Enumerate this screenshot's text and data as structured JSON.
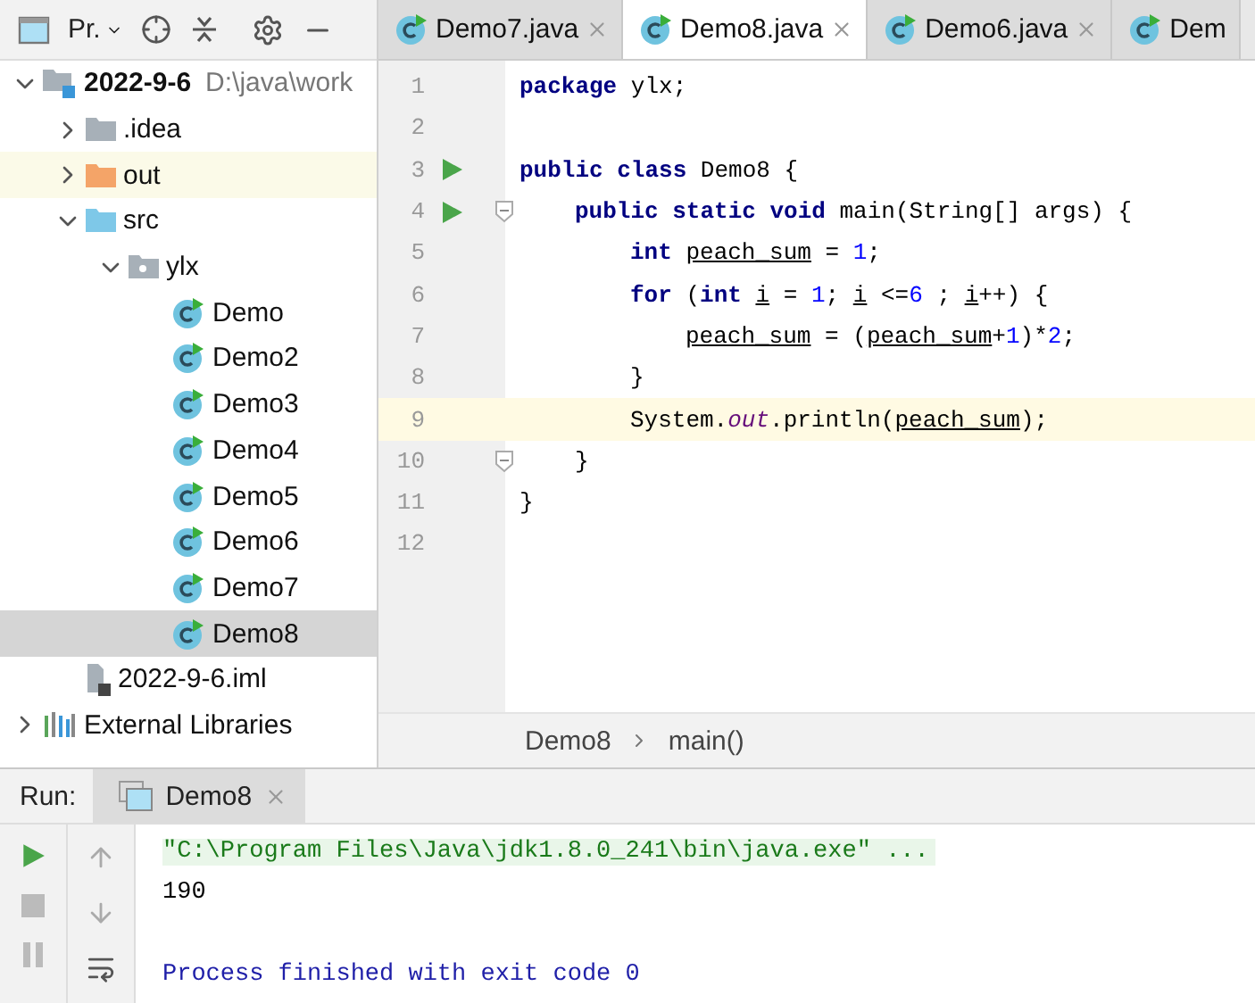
{
  "project_panel": {
    "title": "Pr.",
    "tree": [
      {
        "label": "2022-9-6",
        "path": "D:\\java\\work",
        "kind": "module",
        "expanded": true,
        "selected": false,
        "highlighted": false,
        "children": [
          {
            "label": ".idea",
            "kind": "folder",
            "expanded": false,
            "selected": false,
            "highlighted": false
          },
          {
            "label": "out",
            "kind": "output-folder",
            "expanded": false,
            "selected": false,
            "highlighted": true
          },
          {
            "label": "src",
            "kind": "source-folder",
            "expanded": true,
            "selected": false,
            "highlighted": false,
            "children": [
              {
                "label": "ylx",
                "kind": "package",
                "expanded": true,
                "selected": false,
                "highlighted": false,
                "children": [
                  {
                    "label": "Demo",
                    "kind": "class",
                    "selected": false,
                    "highlighted": false
                  },
                  {
                    "label": "Demo2",
                    "kind": "class",
                    "selected": false,
                    "highlighted": false
                  },
                  {
                    "label": "Demo3",
                    "kind": "class",
                    "selected": false,
                    "highlighted": false
                  },
                  {
                    "label": "Demo4",
                    "kind": "class",
                    "selected": false,
                    "highlighted": false
                  },
                  {
                    "label": "Demo5",
                    "kind": "class",
                    "selected": false,
                    "highlighted": false
                  },
                  {
                    "label": "Demo6",
                    "kind": "class",
                    "selected": false,
                    "highlighted": false
                  },
                  {
                    "label": "Demo7",
                    "kind": "class",
                    "selected": false,
                    "highlighted": false
                  },
                  {
                    "label": "Demo8",
                    "kind": "class",
                    "selected": true,
                    "highlighted": false
                  }
                ]
              }
            ]
          },
          {
            "label": "2022-9-6.iml",
            "kind": "file",
            "selected": false,
            "highlighted": false
          }
        ]
      },
      {
        "label": "External Libraries",
        "kind": "library",
        "expanded": false,
        "selected": false,
        "highlighted": false
      }
    ]
  },
  "editor_tabs": [
    {
      "label": "Demo7.java",
      "selected": false,
      "closable": true
    },
    {
      "label": "Demo8.java",
      "selected": true,
      "closable": true
    },
    {
      "label": "Demo6.java",
      "selected": false,
      "closable": true
    },
    {
      "label": "Dem",
      "selected": false,
      "closable": false
    }
  ],
  "code": [
    {
      "number": "1",
      "run": false,
      "fold": false,
      "current": false,
      "tokens": [
        {
          "kind": "keyword",
          "text": "package"
        },
        {
          "kind": "plain",
          "text": " ylx;"
        }
      ]
    },
    {
      "number": "2",
      "run": false,
      "fold": false,
      "current": false
    },
    {
      "number": "3",
      "run": true,
      "fold": false,
      "current": false,
      "tokens": [
        {
          "kind": "keyword",
          "text": "public class"
        },
        {
          "kind": "plain",
          "text": " Demo8 {"
        }
      ],
      "children": [
        {
          "number": "4",
          "run": true,
          "fold": true,
          "current": false,
          "tokens": [
            {
              "kind": "keyword",
              "text": "public static void"
            },
            {
              "kind": "plain",
              "text": " main(String[] args) {"
            }
          ],
          "children": [
            {
              "number": "5",
              "run": false,
              "fold": false,
              "current": false,
              "tokens": [
                {
                  "kind": "keyword",
                  "text": "int "
                },
                {
                  "kind": "variable",
                  "text": "peach_sum"
                },
                {
                  "kind": "plain",
                  "text": " = "
                },
                {
                  "kind": "number",
                  "text": "1"
                },
                {
                  "kind": "plain",
                  "text": ";"
                }
              ]
            },
            {
              "number": "6",
              "run": false,
              "fold": false,
              "current": false,
              "tokens": [
                {
                  "kind": "keyword",
                  "text": "for"
                },
                {
                  "kind": "plain",
                  "text": " ("
                },
                {
                  "kind": "keyword",
                  "text": "int "
                },
                {
                  "kind": "variable",
                  "text": "i"
                },
                {
                  "kind": "plain",
                  "text": " = "
                },
                {
                  "kind": "number",
                  "text": "1"
                },
                {
                  "kind": "plain",
                  "text": "; "
                },
                {
                  "kind": "variable",
                  "text": "i"
                },
                {
                  "kind": "plain",
                  "text": " <="
                },
                {
                  "kind": "number",
                  "text": "6"
                },
                {
                  "kind": "plain",
                  "text": " ; "
                },
                {
                  "kind": "variable",
                  "text": "i"
                },
                {
                  "kind": "plain",
                  "text": "++) {"
                }
              ],
              "children": [
                {
                  "number": "7",
                  "run": false,
                  "fold": false,
                  "current": false,
                  "tokens": [
                    {
                      "kind": "variable",
                      "text": "peach_sum"
                    },
                    {
                      "kind": "plain",
                      "text": " = ("
                    },
                    {
                      "kind": "variable",
                      "text": "peach_sum"
                    },
                    {
                      "kind": "plain",
                      "text": "+"
                    },
                    {
                      "kind": "number",
                      "text": "1"
                    },
                    {
                      "kind": "plain",
                      "text": ")*"
                    },
                    {
                      "kind": "number",
                      "text": "2"
                    },
                    {
                      "kind": "plain",
                      "text": ";"
                    }
                  ]
                }
              ]
            },
            {
              "number": "8",
              "run": false,
              "fold": false,
              "current": false,
              "tokens": [
                {
                  "kind": "plain",
                  "text": "}"
                }
              ]
            },
            {
              "number": "9",
              "run": false,
              "fold": false,
              "current": true,
              "tokens": [
                {
                  "kind": "plain",
                  "text": "System."
                },
                {
                  "kind": "field",
                  "text": "out"
                },
                {
                  "kind": "plain",
                  "text": ".println("
                },
                {
                  "kind": "variable",
                  "text": "peach_sum"
                },
                {
                  "kind": "plain",
                  "text": ");"
                }
              ]
            }
          ]
        },
        {
          "number": "10",
          "run": false,
          "fold": true,
          "current": false,
          "tokens": [
            {
              "kind": "plain",
              "text": "}"
            }
          ]
        }
      ]
    },
    {
      "number": "11",
      "run": false,
      "fold": false,
      "current": false,
      "tokens": [
        {
          "kind": "plain",
          "text": "}"
        }
      ]
    },
    {
      "number": "12",
      "run": false,
      "fold": false,
      "current": false
    }
  ],
  "breadcrumb": [
    "Demo8",
    "main()"
  ],
  "run_panel": {
    "label": "Run:",
    "tab": "Demo8",
    "console": [
      {
        "kind": "command",
        "text": "\"C:\\Program Files\\Java\\jdk1.8.0_241\\bin\\java.exe\" ..."
      },
      {
        "kind": "output",
        "text": "190"
      },
      {
        "kind": "exit",
        "text": "Process finished with exit code 0"
      }
    ]
  }
}
